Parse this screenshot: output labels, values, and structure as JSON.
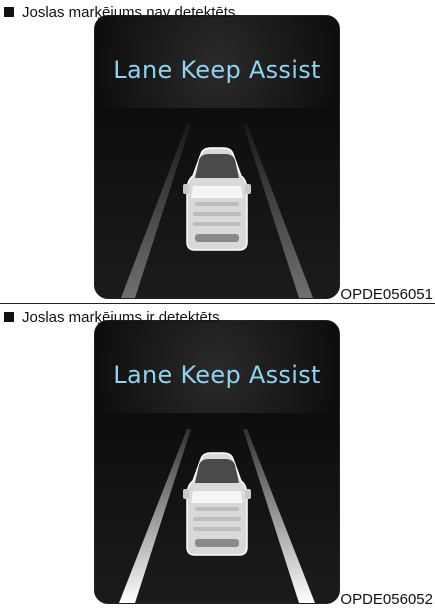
{
  "figures": [
    {
      "caption": "Joslas marķējums nav detektēts",
      "screen_title": "Lane Keep Assist",
      "code": "OPDE056051",
      "lane_markings_detected": false
    },
    {
      "caption": "Joslas marķējums ir detektēts",
      "screen_title": "Lane Keep Assist",
      "code": "OPDE056052",
      "lane_markings_detected": true
    }
  ],
  "colors": {
    "title_text": "#8fd3ee",
    "lane_undetected": "#6f6f6f",
    "lane_detected": "#f2f2f2"
  }
}
